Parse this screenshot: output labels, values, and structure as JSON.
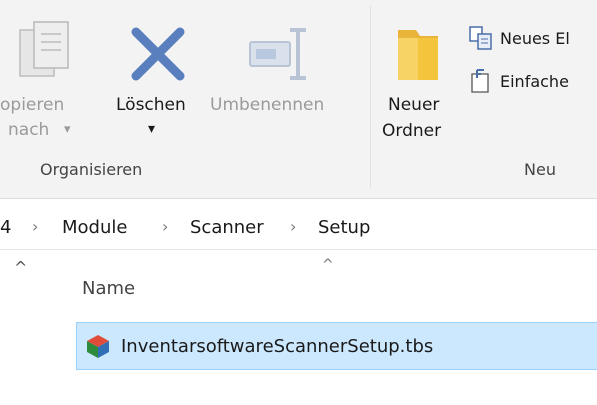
{
  "ribbon": {
    "organize": {
      "copy_to": {
        "line1": "opieren",
        "line2": "nach",
        "chevron": "▾"
      },
      "delete": {
        "label": "Löschen",
        "chevron": "▾"
      },
      "rename": {
        "label": "Umbenennen"
      },
      "group_label": "Organisieren"
    },
    "new": {
      "new_folder": {
        "line1": "Neuer",
        "line2": "Ordner"
      },
      "new_item": {
        "label": "Neues El"
      },
      "easy_access": {
        "label": "Einfache"
      },
      "group_label": "Neu"
    }
  },
  "breadcrumb": {
    "items": [
      "4",
      "Module",
      "Scanner",
      "Setup"
    ],
    "separator": "›"
  },
  "nav": {
    "collapse_glyph": "^"
  },
  "file_list": {
    "column_name": "Name",
    "sort_glyph": "^",
    "rows": [
      {
        "name": "InventarsoftwareScannerSetup.tbs",
        "icon": "tbs-file-icon",
        "selected": true
      }
    ]
  },
  "colors": {
    "accent_blue": "#5a7fbf",
    "selection_bg": "#cce8ff",
    "selection_border": "#99d1ff",
    "folder_yellow": "#f3c43c"
  }
}
